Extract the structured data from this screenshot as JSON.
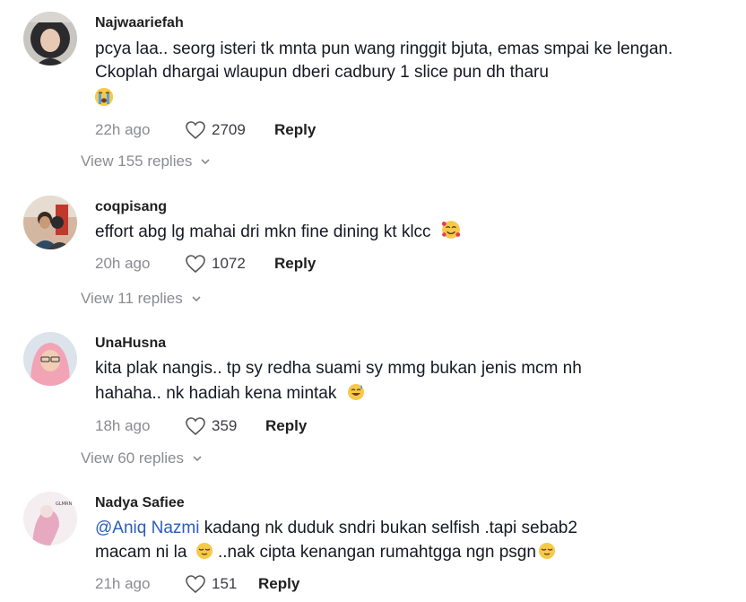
{
  "comments": [
    {
      "username": "Najwaariefah",
      "text": "pcya laa.. seorg isteri tk mnta pun wang ringgit bjuta, emas smpai ke lengan. Ckoplah dhargai wlaupun dberi cadbury 1 slice pun dh tharu",
      "emoji": "loudly-crying-face",
      "time": "22h ago",
      "likes": "2709",
      "reply_label": "Reply",
      "view_replies": "View 155 replies"
    },
    {
      "username": "coqpisang",
      "text": "effort abg lg mahai dri mkn fine dining kt klcc",
      "emoji": "smiling-face-with-hearts",
      "time": "20h ago",
      "likes": "1072",
      "reply_label": "Reply",
      "view_replies": "View 11 replies"
    },
    {
      "username": "UnaHusna",
      "text_line1": "kita plak nangis.. tp sy redha suami sy mmg bukan jenis mcm nh",
      "text_line2": "hahaha.. nk hadiah kena mintak",
      "emoji": "grinning-face-with-sweat",
      "time": "18h ago",
      "likes": "359",
      "reply_label": "Reply",
      "view_replies": "View 60 replies"
    },
    {
      "username": "Nadya Safiee",
      "mention": "@Aniq Nazmi",
      "text_line1": " kadang nk duduk sndri bukan selfish .tapi sebab2",
      "text_line2a": "macam ni la",
      "text_line2b": " ..nak cipta kenangan rumahtgga ngn psgn",
      "emoji": "relieved-face",
      "avatar_text": "GLMRN",
      "time": "21h ago",
      "likes": "151",
      "reply_label": "Reply"
    }
  ],
  "colors": {
    "muted": "#8a8b91",
    "mention": "#2b5db9",
    "text": "#161823"
  }
}
